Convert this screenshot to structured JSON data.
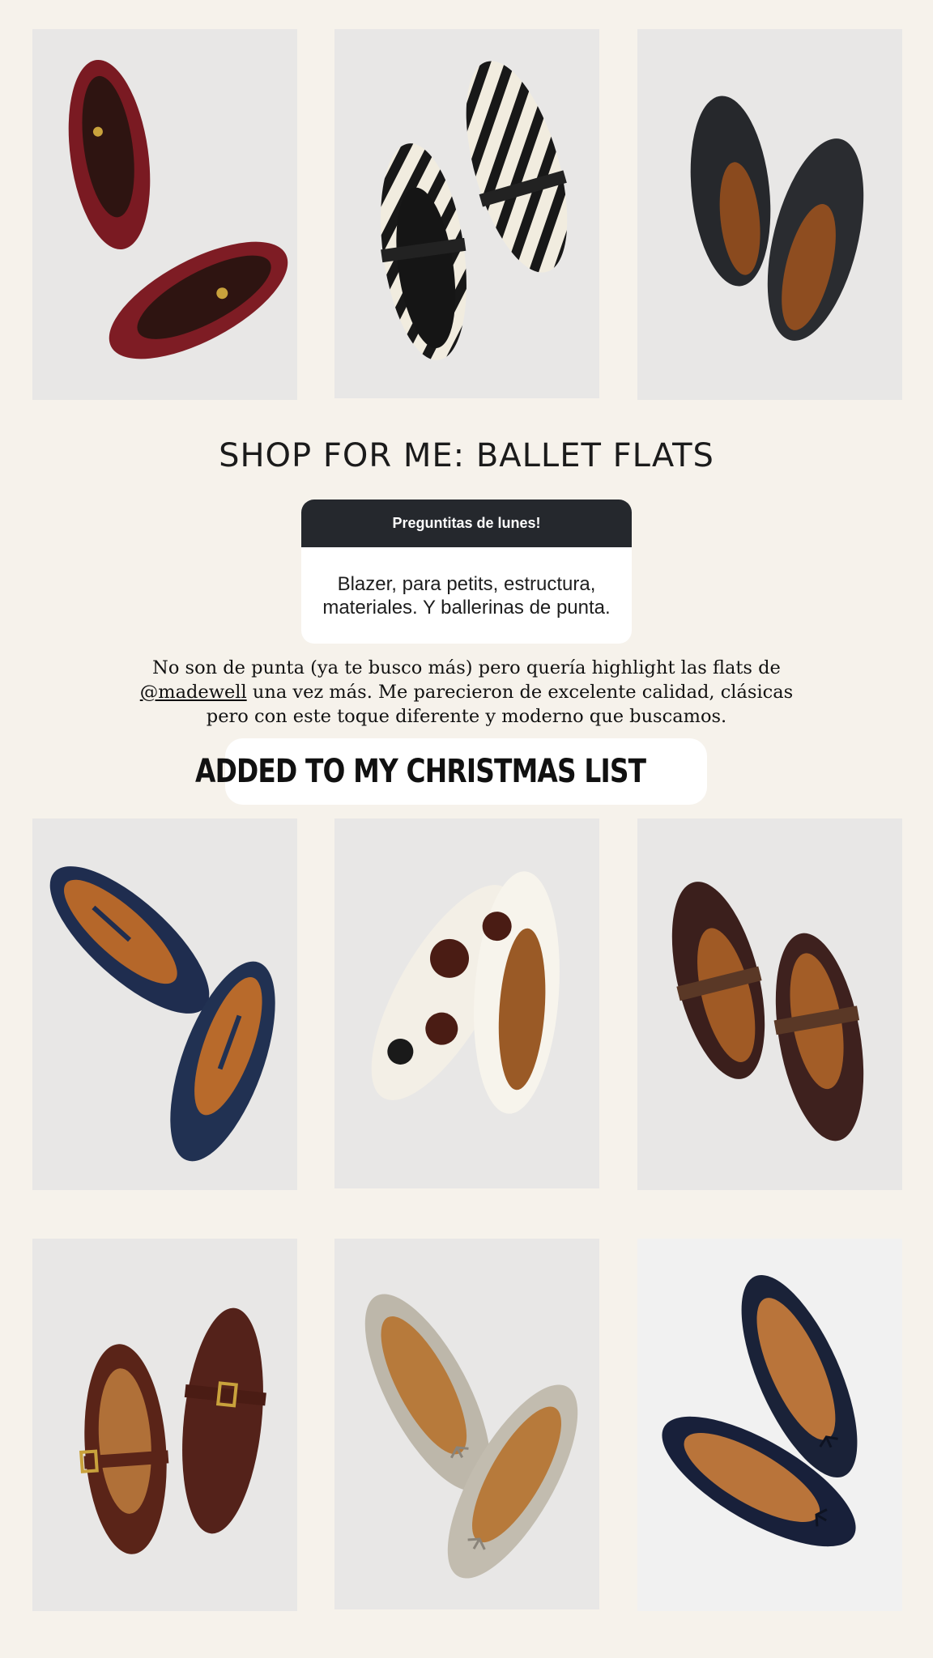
{
  "headline": "SHOP FOR ME: BALLET FLATS",
  "question_sticker": {
    "header": "Preguntitas de lunes!",
    "answer": "Blazer, para petits, estructura, materiales. Y ballerinas de punta."
  },
  "caption": {
    "part1": "No son de punta (ya te busco más) pero quería highlight las flats de ",
    "mention": "@madewell",
    "part2": " una vez más. Me parecieron de excelente calidad, clásicas pero con este toque diferente y moderno que buscamos."
  },
  "link_sticker": {
    "label": "ADDED TO MY CHRISTMAS LIST",
    "icon": "link-icon"
  },
  "products": [
    {
      "name": "burgundy-suede-charm-flats",
      "color": "#7a1a22"
    },
    {
      "name": "zebra-calf-hair-mary-janes",
      "color": "#1c1c1c"
    },
    {
      "name": "black-calf-hair-flats",
      "color": "#26282c"
    },
    {
      "name": "navy-suede-t-strap-flats",
      "color": "#1f2d4f"
    },
    {
      "name": "cow-print-calf-hair-flats",
      "color": "#f3efe6"
    },
    {
      "name": "brown-calf-hair-buckle-mary-janes",
      "color": "#3b1f1c"
    },
    {
      "name": "brown-suede-buckle-mary-janes",
      "color": "#5a2418"
    },
    {
      "name": "grey-suede-bow-flats",
      "color": "#bdb7aa"
    },
    {
      "name": "navy-suede-bow-flats",
      "color": "#1a2238"
    }
  ]
}
